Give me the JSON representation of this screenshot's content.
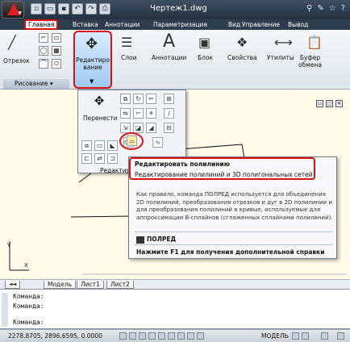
{
  "title_bar": {
    "document_title": "Чертеж1.dwg",
    "logo_icon": "autocad-logo-icon",
    "quick_access": [
      "new-icon",
      "open-icon",
      "save-icon",
      "undo-icon",
      "redo-icon",
      "plot-icon"
    ],
    "tools": [
      "binoculars-icon",
      "tools-icon",
      "star-icon",
      "help-icon"
    ]
  },
  "ribbon_tabs": [
    "Главная",
    "Вставка",
    "Аннотации",
    "Параметризация",
    "Вид",
    "Управление",
    "Вывод"
  ],
  "ribbon": {
    "polyline_label": "Отрезок",
    "draw_panel_label": "Рисование",
    "edit_label": "Редактиро\nвание",
    "layers_label": "Слои",
    "annotations_label": "Аннотации",
    "block_label": "Блок",
    "properties_label": "Свойства",
    "utilities_label": "Утилиты",
    "clipboard_label": "Буфер\nобмена"
  },
  "flyout": {
    "move_label": "Перенести",
    "footer_label": "Редактир"
  },
  "tooltip": {
    "title": "Редактировать полилинию",
    "subtitle": "Редактирование полилиний и 3D полигональных сетей",
    "body": "Как правило, команда ПОЛРЕД используется для объединения 2D полилиний, преобразования отрезков и дуг в 2D полилинии и для преобразования полилиний в кривые, используемые для аппроксимации В-сплайнов (сглаженных сплайнами полилиний).",
    "command": "ПОЛРЕД",
    "help": "Нажмите F1 для получения дополнительной справки"
  },
  "layout_tabs": [
    "Модель",
    "Лист1",
    "Лист2"
  ],
  "command_lines": [
    "Команда:",
    "Команда:",
    "Команда:"
  ],
  "status_bar": {
    "coordinates": "2278.8705, 2896.6595, 0.0000",
    "model_label": "МОДЕЛЬ"
  },
  "colors": {
    "highlight_red": "#dd1111",
    "drawing_bg": "#fffbe8",
    "title_bg": "#2e3d4e"
  }
}
